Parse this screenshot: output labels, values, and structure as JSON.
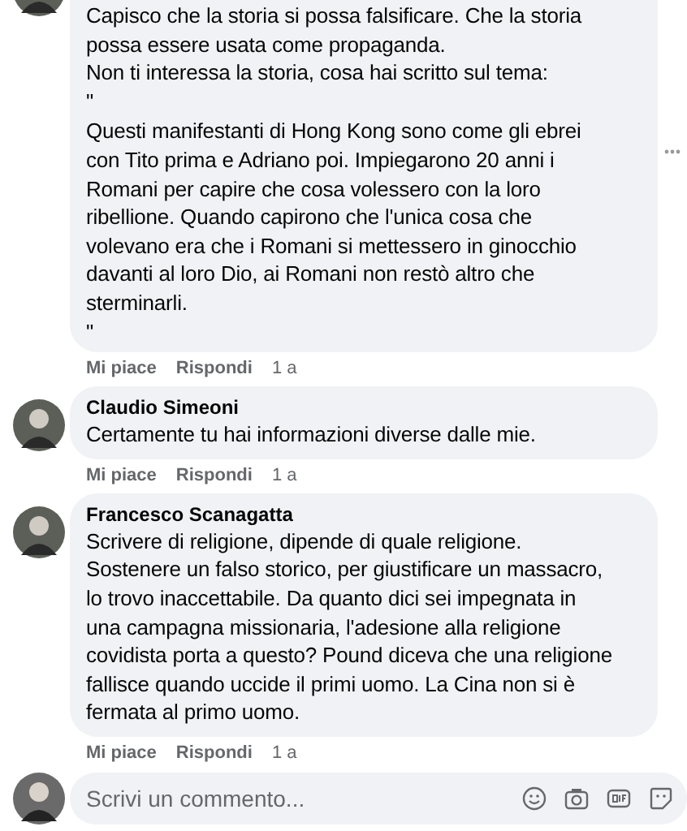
{
  "comments": [
    {
      "paragraphs": [
        "Capisco che la storia si possa falsificare. Che la storia\npossa essere usata come propaganda.\nNon ti interessa la storia, cosa hai scritto sul tema:\n\"",
        "Questi manifestanti di Hong Kong sono come gli ebrei\ncon Tito prima e Adriano poi. Impiegarono 20 anni i\nRomani per capire che cosa volessero con la loro\nribellione. Quando capirono che l'unica cosa che\nvolevano era che i Romani si mettessero in ginocchio\ndavanti al loro Dio, ai Romani non restò altro che\nsterminarli.\n\""
      ],
      "actions": [
        "Mi piace",
        "Rispondi"
      ],
      "time": "1 a",
      "menu": true
    },
    {
      "author": "Claudio Simeoni",
      "paragraphs": [
        "Certamente tu hai informazioni diverse dalle mie."
      ],
      "actions": [
        "Mi piace",
        "Rispondi"
      ],
      "time": "1 a"
    },
    {
      "author": "Francesco Scanagatta",
      "paragraphs": [
        "Scrivere di religione, dipende di quale religione.\nSostenere un falso storico, per giustificare un massacro,\nlo trovo inaccettabile. Da quanto dici sei impegnata in\nuna campagna missionaria, l'adesione alla religione\ncovidista porta a questo? Pound diceva che una religione\nfallisce quando uccide il primi uomo. La Cina non si è\nfermata al primo uomo."
      ],
      "actions": [
        "Mi piace",
        "Rispondi"
      ],
      "time": "1 a"
    }
  ],
  "composer": {
    "placeholder": "Scrivi un commento..."
  }
}
